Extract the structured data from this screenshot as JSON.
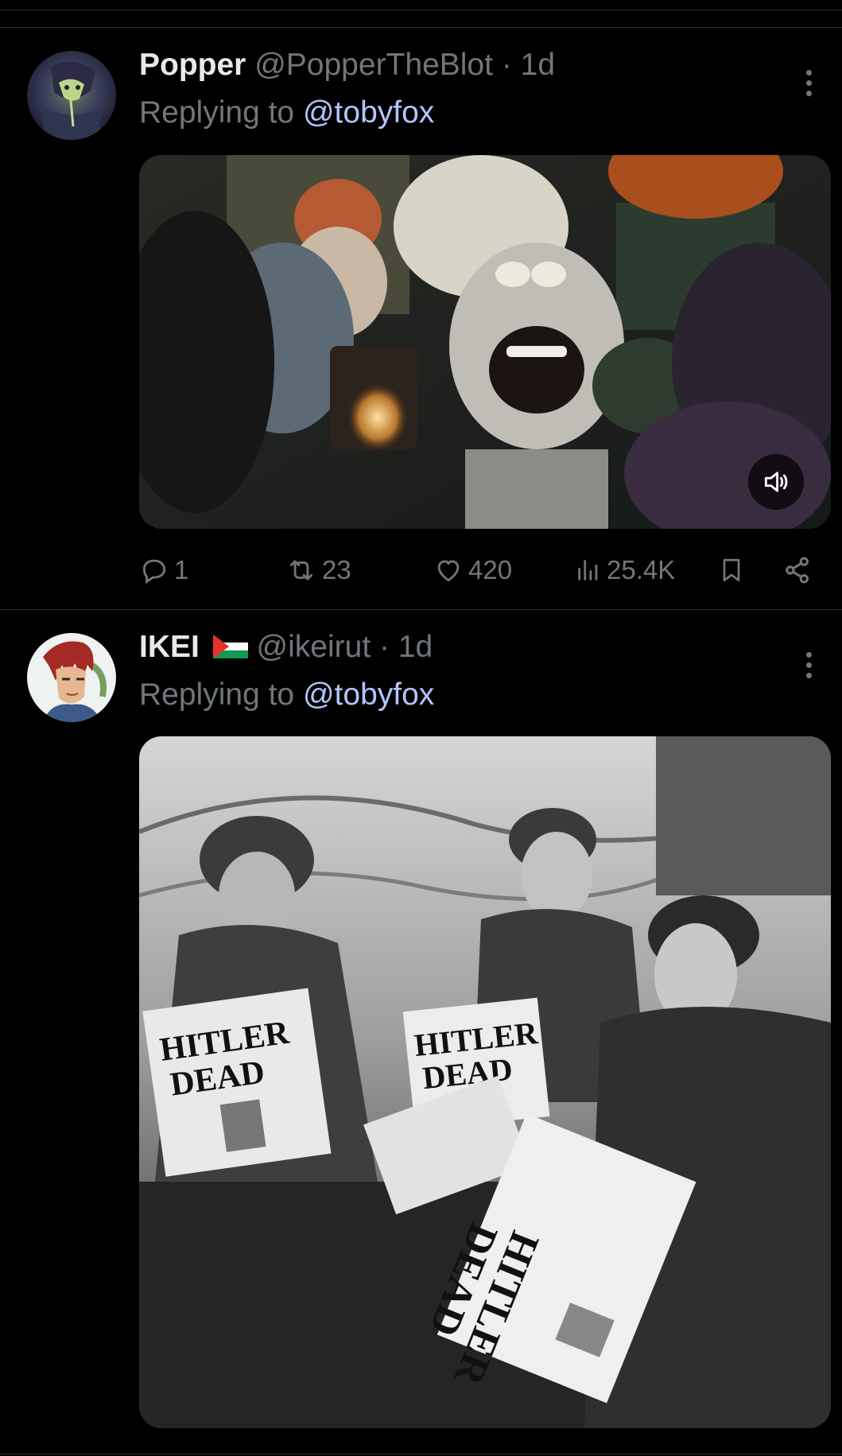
{
  "tweets": [
    {
      "display_name": "Popper",
      "handle": "@PopperTheBlot",
      "separator": "·",
      "time": "1d",
      "replying_prefix": "Replying to",
      "replying_to": "@tobyfox",
      "media": {
        "type": "video",
        "icon": "speaker-icon"
      },
      "stats": {
        "replies": "1",
        "reposts": "23",
        "likes": "420",
        "views": "25.4K"
      }
    },
    {
      "display_name": "IKEI",
      "flag_icon": "palestine-flag-icon",
      "handle": "@ikeirut",
      "separator": "·",
      "time": "1d",
      "replying_prefix": "Replying to",
      "replying_to": "@tobyfox",
      "media": {
        "type": "photo",
        "headline_1": "HITLER",
        "headline_2": "DEAD"
      }
    }
  ],
  "colors": {
    "background": "#000000",
    "secondary_text": "#71767b",
    "mention": "#b2c5ff",
    "divider": "#2f3336"
  }
}
